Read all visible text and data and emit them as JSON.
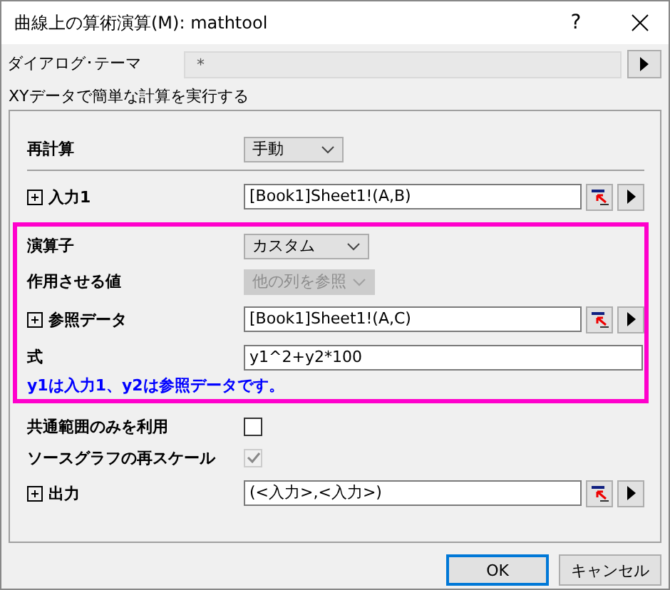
{
  "window": {
    "title": "曲線上の算術演算(M): mathtool",
    "help": "?"
  },
  "theme": {
    "label": "ダイアログ･テーマ",
    "value": "*"
  },
  "description": "XYデータで簡単な計算を実行する",
  "sections": [
    {
      "highlighted": false,
      "rows": [
        {
          "kind": "dropdown",
          "label": "再計算",
          "value": "手動",
          "disabled": false,
          "divider_after": true
        },
        {
          "kind": "range",
          "label": "入力1",
          "value": "[Book1]Sheet1!(A,B)",
          "expanded": false
        }
      ]
    },
    {
      "highlighted": true,
      "rows": [
        {
          "kind": "dropdown",
          "label": "演算子",
          "value": "カスタム",
          "disabled": false
        },
        {
          "kind": "dropdown",
          "label": "作用させる値",
          "value": "他の列を参照",
          "disabled": true
        },
        {
          "kind": "range",
          "label": "参照データ",
          "value": "[Book1]Sheet1!(A,C)",
          "expanded": false
        },
        {
          "kind": "text",
          "label": "式",
          "value": "y1^2+y2*100"
        },
        {
          "kind": "note",
          "label": "y1は入力1、y2は参照データです。"
        }
      ]
    },
    {
      "highlighted": false,
      "rows": [
        {
          "kind": "checkbox",
          "label": "共通範囲のみを利用",
          "checked": false,
          "disabled": false
        },
        {
          "kind": "checkbox",
          "label": "ソースグラフの再スケール",
          "checked": true,
          "disabled": true
        },
        {
          "kind": "range",
          "label": "出力",
          "value": "(<入力>,<入力>)",
          "expanded": false
        }
      ]
    }
  ],
  "buttons": [
    {
      "label": "OK",
      "default": true
    },
    {
      "label": "キャンセル",
      "default": false
    }
  ]
}
